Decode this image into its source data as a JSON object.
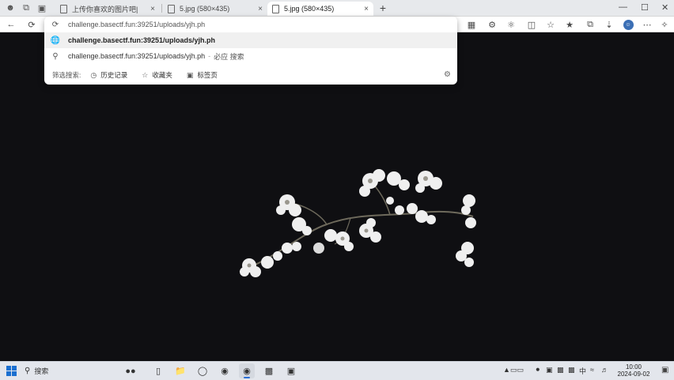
{
  "tabs": [
    {
      "label": "上传你喜欢的图片吧|",
      "active": false
    },
    {
      "label": "5.jpg (580×435)",
      "active": false
    },
    {
      "label": "5.jpg (580×435)",
      "active": true
    }
  ],
  "tab_close_glyph": "×",
  "new_tab_glyph": "+",
  "address_bar": {
    "typed_text": "challenge.basectf.fun:39251/uploads/yjh.ph"
  },
  "suggestions": [
    {
      "icon": "globe-icon",
      "text": "challenge.basectf.fun:39251/uploads/yjh.ph"
    },
    {
      "icon": "search-icon",
      "text": "challenge.basectf.fun:39251/uploads/yjh.ph",
      "separator": "-",
      "action": "必应 搜索"
    }
  ],
  "filters": {
    "label": "筛选搜索:",
    "chips": [
      {
        "icon": "history-icon",
        "label": "历史记录"
      },
      {
        "icon": "star-icon",
        "label": "收藏夹"
      },
      {
        "icon": "tabs-icon",
        "label": "标签页"
      }
    ]
  },
  "taskbar": {
    "search_label": "搜索",
    "time": "10:00",
    "date": "2024-09-02"
  },
  "colors": {
    "page_background": "#0f0f12",
    "accent": "#2a6fd6",
    "selected_row": "#f0f0f0"
  }
}
